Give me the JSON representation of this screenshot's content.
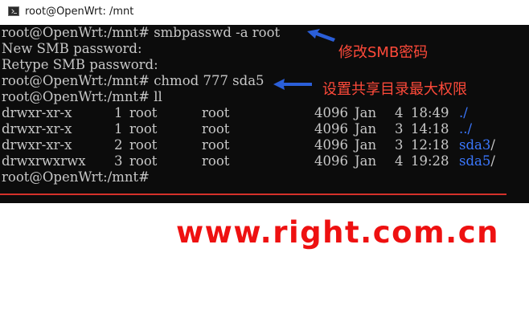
{
  "window": {
    "title": "root@OpenWrt: /mnt",
    "icon": "console-app-icon"
  },
  "terminal": {
    "lines": [
      "root@OpenWrt:/mnt# smbpasswd -a root",
      "New SMB password:",
      "Retype SMB password:",
      "root@OpenWrt:/mnt# chmod 777 sda5",
      "root@OpenWrt:/mnt# ll"
    ],
    "listing": [
      {
        "perms": "drwxr-xr-x",
        "links": "1",
        "owner": "root",
        "group": "root",
        "size": "4096",
        "month": "Jan",
        "day": "4",
        "time": "18:49",
        "name": "./",
        "name_color": "#3b78ff"
      },
      {
        "perms": "drwxr-xr-x",
        "links": "1",
        "owner": "root",
        "group": "root",
        "size": "4096",
        "month": "Jan",
        "day": "3",
        "time": "14:18",
        "name": "../",
        "name_color": "#3b78ff"
      },
      {
        "perms": "drwxr-xr-x",
        "links": "2",
        "owner": "root",
        "group": "root",
        "size": "4096",
        "month": "Jan",
        "day": "3",
        "time": "12:18",
        "name_main": "sda3",
        "name_suffix": "/",
        "name_color": "#3b78ff"
      },
      {
        "perms": "drwxrwxrwx",
        "links": "3",
        "owner": "root",
        "group": "root",
        "size": "4096",
        "month": "Jan",
        "day": "4",
        "time": "19:28",
        "name_main": "sda5",
        "name_suffix": "/",
        "name_color": "#3b78ff"
      }
    ],
    "final_prompt": "root@OpenWrt:/mnt#"
  },
  "annotations": {
    "note1": "修改SMB密码",
    "note2": "设置共享目录最大权限",
    "color": "#ff4a3a"
  },
  "watermark": {
    "text": "www.right.com.cn",
    "color": "#ee1111"
  },
  "colors": {
    "terminal_bg": "#0c0c0c",
    "terminal_fg": "#c8c8c8",
    "dir_blue": "#3b78ff",
    "underline_red": "#d4312b"
  }
}
